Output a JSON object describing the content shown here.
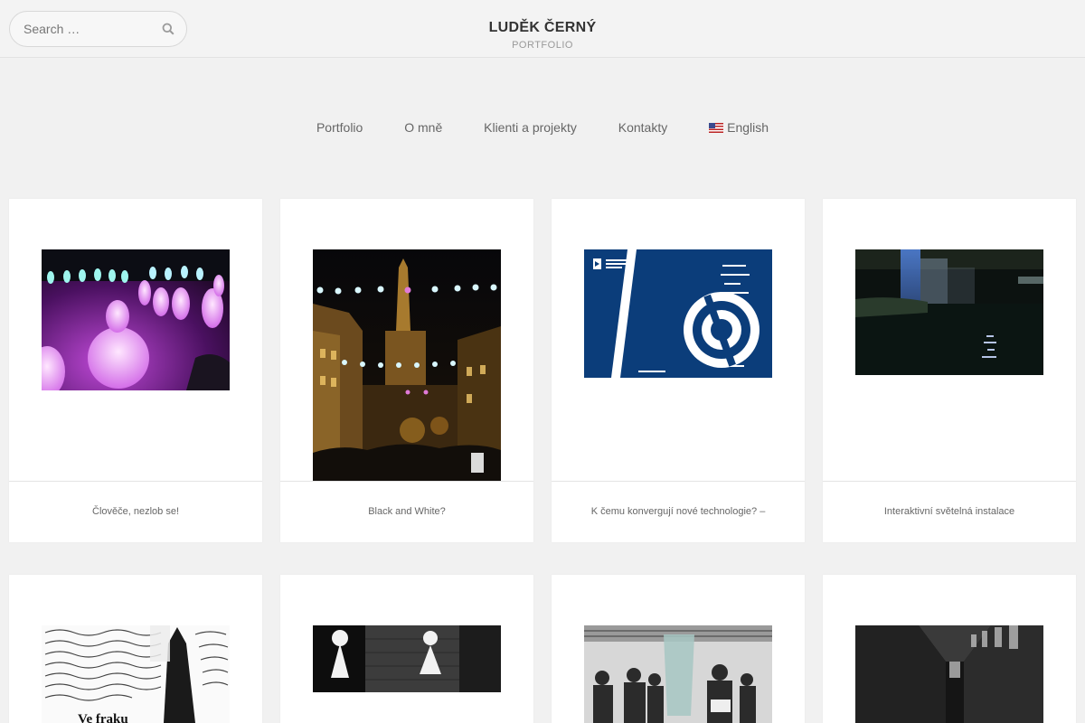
{
  "header": {
    "title": "LUDĚK ČERNÝ",
    "subtitle": "PORTFOLIO",
    "search_placeholder": "Search …",
    "search_icon": "search-icon"
  },
  "nav": {
    "items": [
      {
        "label": "Portfolio"
      },
      {
        "label": "O mně"
      },
      {
        "label": "Klienti a projekty"
      },
      {
        "label": "Kontakty"
      },
      {
        "label": "English",
        "icon": "us-flag-icon"
      }
    ]
  },
  "portfolio": {
    "items": [
      {
        "title": "Člověče, nezlob se!"
      },
      {
        "title": "Black and White?"
      },
      {
        "title": "K čemu konvergují nové technologie? –"
      },
      {
        "title": "Interaktivní světelná instalace"
      },
      {
        "title": "",
        "image_text": "Ve fraku"
      },
      {
        "title": ""
      },
      {
        "title": ""
      },
      {
        "title": ""
      }
    ]
  },
  "colors": {
    "background": "#f1f1f1",
    "card": "#ffffff",
    "title": "#333333",
    "book_blue": "#0b3d7a"
  }
}
